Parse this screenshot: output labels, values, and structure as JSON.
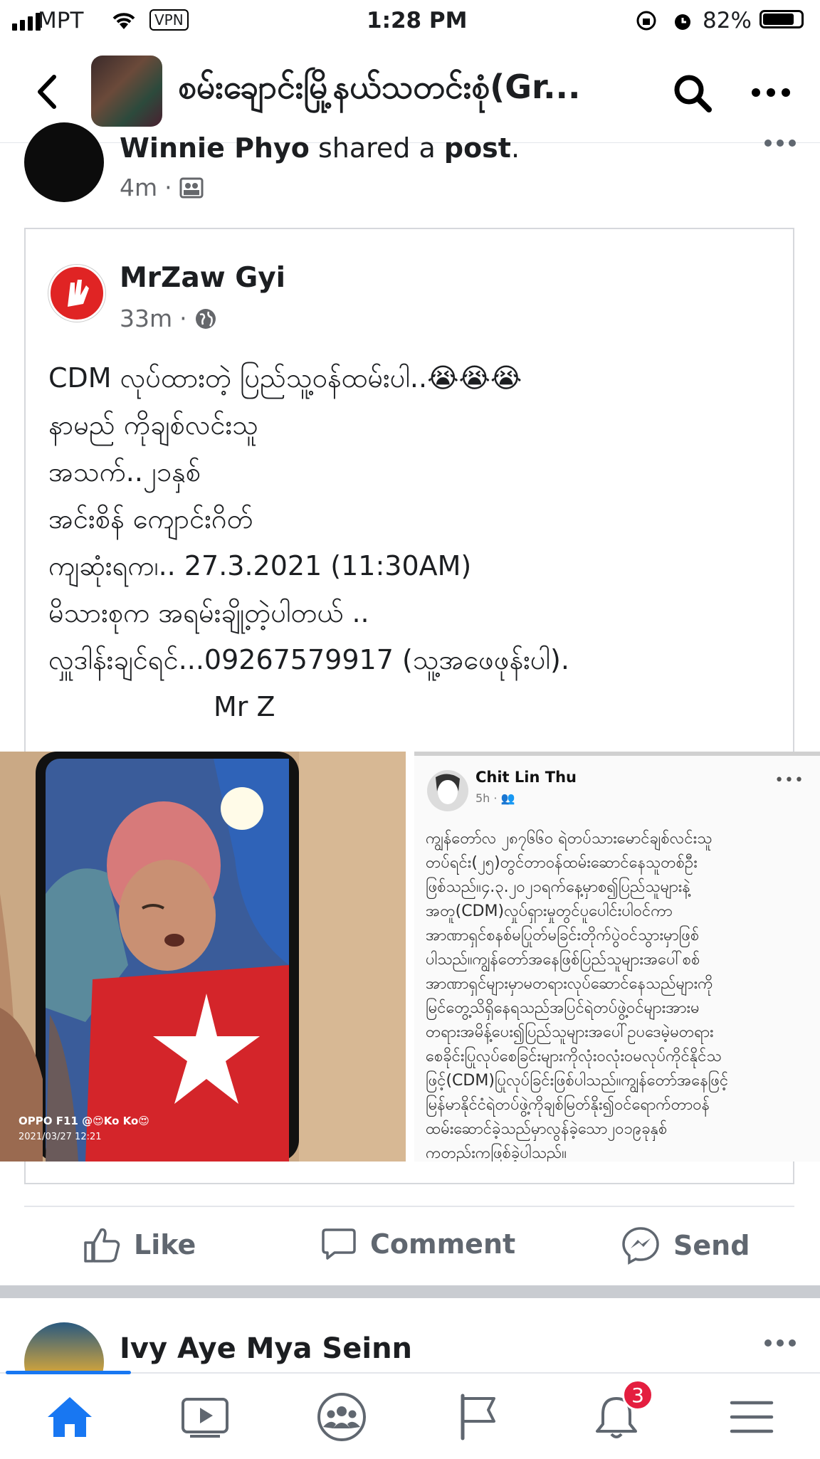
{
  "status_bar": {
    "carrier": "MPT",
    "vpn": "VPN",
    "time": "1:28 PM",
    "battery": "82%"
  },
  "header": {
    "group_title": "စမ်းချောင်းမြို့နယ်သတင်းစုံ(Gr...",
    "icons": [
      "back-icon",
      "search-icon",
      "more-icon"
    ]
  },
  "post": {
    "author": "Winnie Phyo",
    "action_pre": "shared a",
    "action_obj": "post",
    "action_end": ".",
    "time": "4m",
    "privacy_icon": "group-icon"
  },
  "shared_post": {
    "author": "MrZaw Gyi",
    "time": "33m",
    "privacy_icon": "globe-icon",
    "lines": [
      "CDM လုပ်ထားတဲ့ ပြည်သူ့ဝန်ထမ်းပါ..😭😭😭",
      "နာမည် ကိုချစ်လင်းသူ",
      "အသက်..၂၁နှစ်",
      "အင်းစိန် ကျောင်းဂိတ်",
      "ကျဆုံးရက၊.. 27.3.2021 (11:30AM)",
      "မိသားစုက အရမ်းချို့တဲ့ပါတယ် ..",
      "လှူဒါန်းချင်ရင်...09267579917 (သူ့အဖေဖုန်းပါ)."
    ],
    "signature": "Mr Z"
  },
  "photo": {
    "watermark_device": "OPPO F11",
    "watermark_user": "@😍Ko Ko😍",
    "watermark_time": "2021/03/27 12:21"
  },
  "screenshot_post": {
    "author": "Chit Lin Thu",
    "time": "5h",
    "lines": [
      "ကျွန်တော်လ ၂၈၇၆၆၀ ရဲတပ်သားမောင်ချစ်လင်းသူ",
      "တပ်ရင်း(၂၅)တွင်တာဝန်ထမ်းဆောင်နေသူတစ်ဦး",
      "ဖြစ်သည်။၄.၃.၂၀၂၁ရက်နေ့မှာစ၍ပြည်သူများနဲ့",
      "အတူ(CDM)လှုပ်ရှားမှုတွင်ပူပေါင်းပါဝင်ကာ",
      "အာဏာရှင်စနစ်မပြုတ်မခြင်းတိုက်ပွဲဝင်သွားမှာဖြစ်",
      "ပါသည်။ကျွန်တော်အနေဖြစ်ပြည်သူများအပေါ်စစ်",
      "အာဏာရှင်များမှာမတရားလုပ်ဆောင်နေသည်များကို",
      "မြင်တွေ့သိရှိနေရသည်အပြင်ရဲတပ်ဖွဲ့ဝင်များအားမ",
      "တရားအမိန့်ပေး၍ပြည်သူများအပေါ်ဥပဒေမဲ့မတရား",
      "စေခိုင်းပြုလုပ်စေခြင်းများကိုလုံးဝလုံးဝမလုပ်ကိုင်နိုင်သ",
      "ဖြင့်(CDM)ပြုလုပ်ခြင်းဖြစ်ပါသည်။ကျွန်တော်အနေဖြင့်",
      "မြန်မာနိုင်ငံရဲတပ်ဖွဲ့ကိုချစ်မြတ်နိုး၍ဝင်ရောက်တာဝန်",
      "ထမ်းဆောင်ခဲ့သည်မှာလွန်ခဲ့သော၂၀၁၉ခုနှစ်",
      "ကတည်းကဖြစ်ခဲ့ပါသည်။"
    ]
  },
  "actions": {
    "like": "Like",
    "comment": "Comment",
    "send": "Send"
  },
  "next_post": {
    "author": "Ivy Aye Mya Seinn"
  },
  "tab_bar": {
    "notifications_badge": "3",
    "tabs": [
      "home-icon",
      "video-icon",
      "groups-icon",
      "pages-icon",
      "notifications-icon",
      "menu-icon"
    ]
  },
  "colors": {
    "fb_blue": "#1877f2",
    "badge_red": "#e41e3f"
  }
}
